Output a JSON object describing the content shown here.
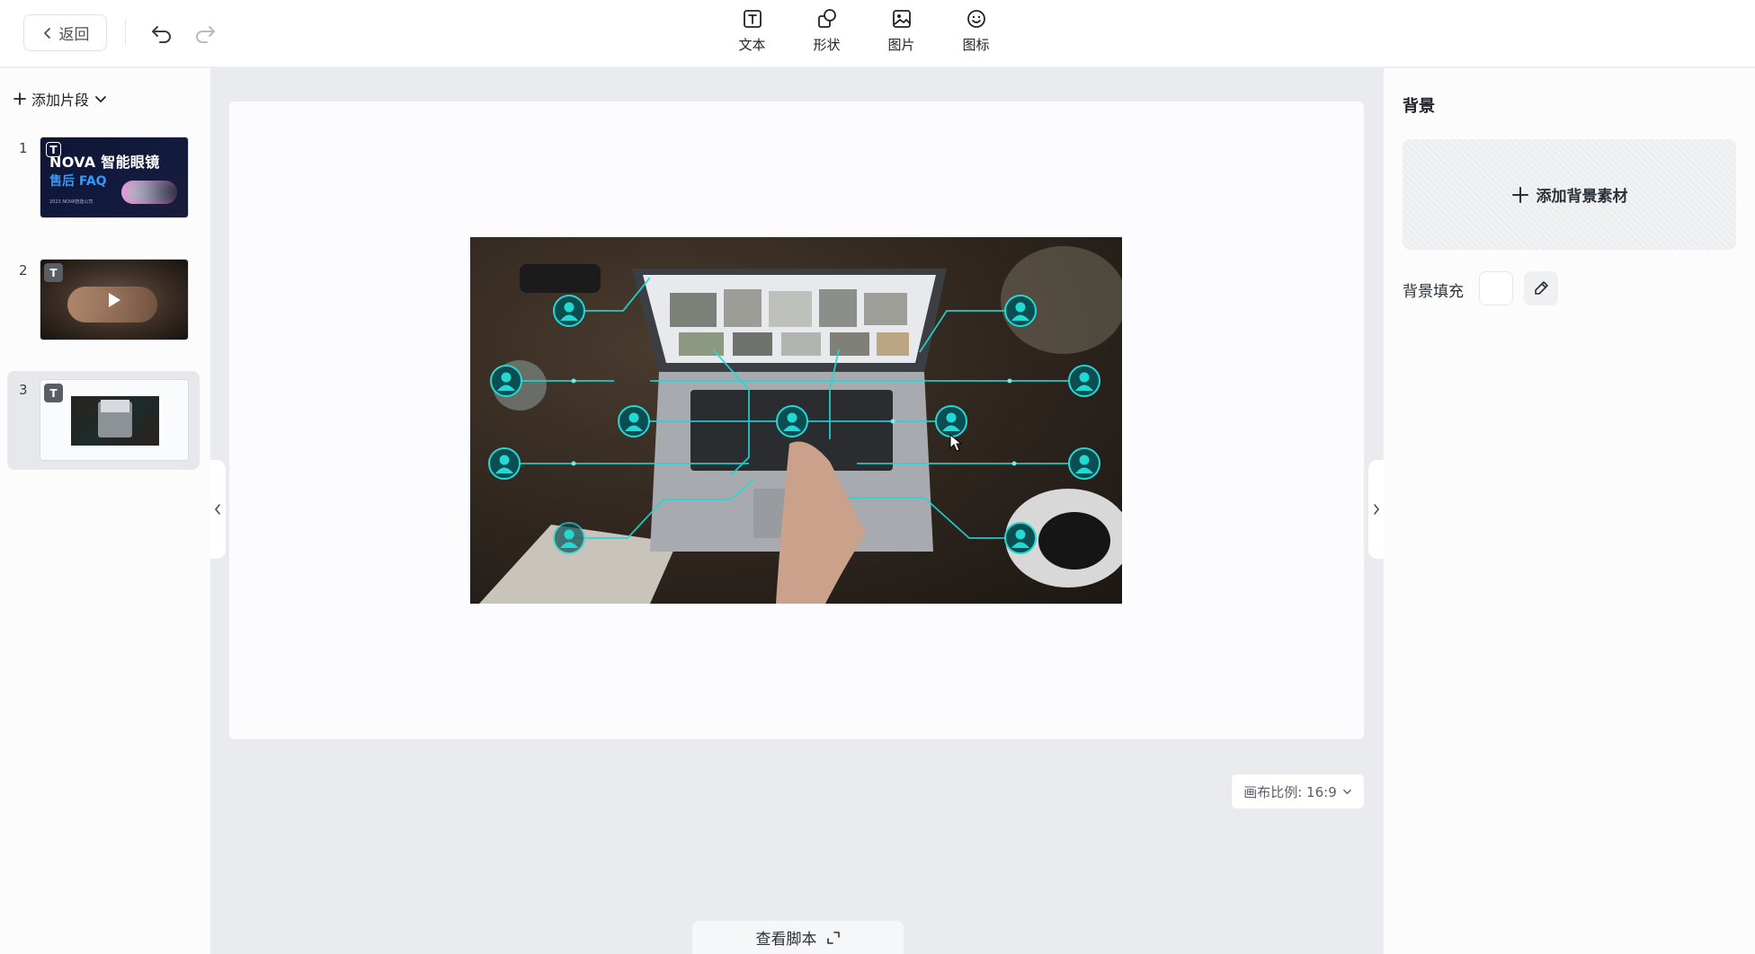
{
  "toolbar": {
    "back_label": "返回",
    "undo_icon": "undo-icon",
    "redo_icon": "redo-icon",
    "tools": [
      {
        "label": "文本",
        "icon": "text-box-icon"
      },
      {
        "label": "形状",
        "icon": "shapes-icon"
      },
      {
        "label": "图片",
        "icon": "image-icon"
      },
      {
        "label": "图标",
        "icon": "smiley-icon"
      }
    ]
  },
  "sidebar": {
    "add_segment_label": "添加片段",
    "slides": [
      {
        "number": "1",
        "badge": "T",
        "title": "NOVA 智能眼镜",
        "subtitle": "售后 FAQ",
        "footnote": "2023 NOVA智能公司"
      },
      {
        "number": "2",
        "badge": "T"
      },
      {
        "number": "3",
        "badge": "T",
        "active": true
      }
    ]
  },
  "canvas": {
    "ratio_label": "画布比例: 16:9",
    "script_label": "查看脚本"
  },
  "right_panel": {
    "title": "背景",
    "add_background_label": "添加背景素材",
    "fill_label": "背景填充",
    "fill_color": "#ffffff"
  },
  "colors": {
    "accent_cyan": "#1fd6d2",
    "panel_bg": "#fcfcfd",
    "workspace_bg": "#e9ebee"
  }
}
